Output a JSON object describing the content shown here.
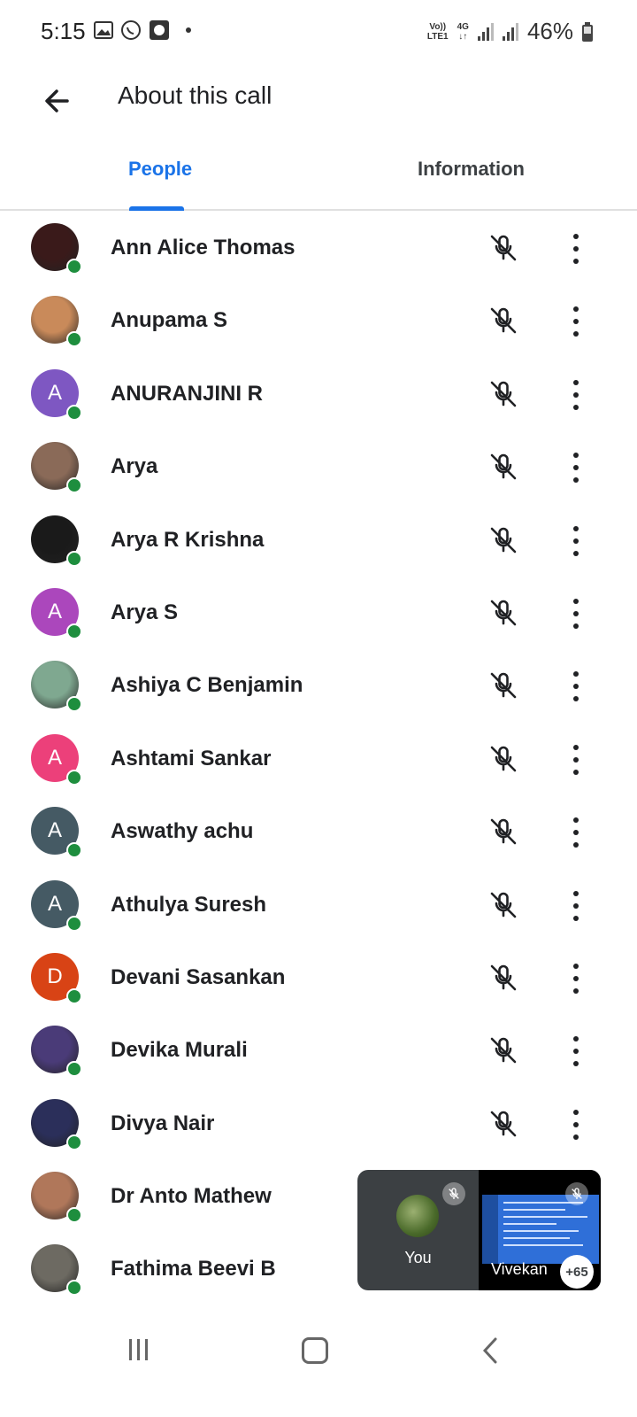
{
  "status_bar": {
    "time": "5:15",
    "network_top": "Vo))",
    "network_bottom": "LTE1",
    "network_type": "4G",
    "battery": "46%"
  },
  "header": {
    "title": "About this call"
  },
  "tabs": {
    "people": "People",
    "information": "Information"
  },
  "participants": [
    {
      "name": "Ann Alice Thomas",
      "avatar": "photo",
      "color": "#3a1a1a"
    },
    {
      "name": "Anupama S",
      "avatar": "photo",
      "color": "#c98a5a"
    },
    {
      "name": "ANURANJINI R",
      "avatar": "A",
      "color": "#7e57c2"
    },
    {
      "name": "Arya",
      "avatar": "photo",
      "color": "#8a6a58"
    },
    {
      "name": "Arya R Krishna",
      "avatar": "photo",
      "color": "#1a1a1a"
    },
    {
      "name": "Arya S",
      "avatar": "A",
      "color": "#ab47bc"
    },
    {
      "name": "Ashiya C Benjamin",
      "avatar": "photo",
      "color": "#7fa890"
    },
    {
      "name": "Ashtami Sankar",
      "avatar": "A",
      "color": "#ec407a"
    },
    {
      "name": "Aswathy achu",
      "avatar": "A",
      "color": "#455a64"
    },
    {
      "name": "Athulya Suresh",
      "avatar": "A",
      "color": "#455a64"
    },
    {
      "name": "Devani Sasankan",
      "avatar": "D",
      "color": "#d84315"
    },
    {
      "name": "Devika Murali",
      "avatar": "photo",
      "color": "#4a3b78"
    },
    {
      "name": "Divya Nair",
      "avatar": "photo",
      "color": "#2b2f5a"
    },
    {
      "name": "Dr Anto Mathew",
      "avatar": "photo",
      "color": "#b0775a"
    },
    {
      "name": "Fathima Beevi B",
      "avatar": "photo",
      "color": "#6d6a62"
    }
  ],
  "self_view": {
    "label": "You"
  },
  "other_tile": {
    "name": "Vivekan",
    "more_count": "+65"
  },
  "icons": {
    "mic_off": "mic-off-icon",
    "more": "more-vert-icon"
  }
}
